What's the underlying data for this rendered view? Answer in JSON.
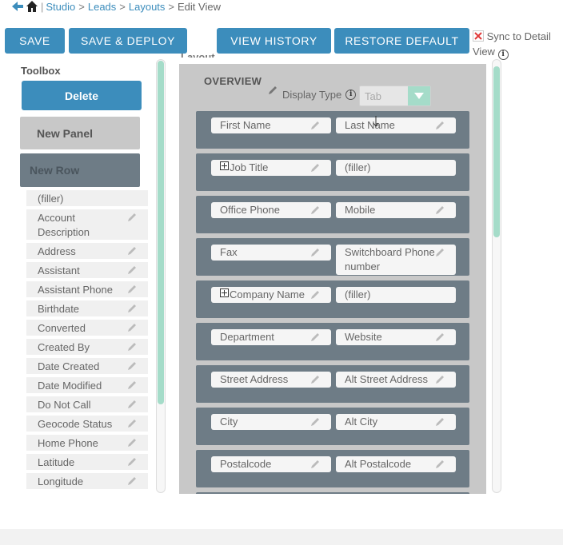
{
  "breadcrumb": {
    "items": [
      "Studio",
      "Leads",
      "Layouts"
    ],
    "separator": ">",
    "current": "Edit View"
  },
  "toolbar": {
    "save": "SAVE",
    "save_deploy": "SAVE & DEPLOY",
    "view_history": "VIEW HISTORY",
    "restore_default": "RESTORE DEFAULT",
    "sync_label": "Sync to Detail View"
  },
  "toolbox": {
    "title": "Toolbox",
    "delete": "Delete",
    "new_panel": "New Panel",
    "new_row": "New Row",
    "fields": [
      "(filler)",
      "Account Description",
      "Address",
      "Assistant",
      "Assistant Phone",
      "Birthdate",
      "Converted",
      "Created By",
      "Date Created",
      "Date Modified",
      "Do Not Call",
      "Geocode Status",
      "Home Phone",
      "Latitude",
      "Longitude"
    ]
  },
  "layout": {
    "label": "Layout",
    "panel_title": "OVERVIEW",
    "display_type_label": "Display Type",
    "display_type_value": "Tab",
    "rows": [
      [
        "First Name",
        "Last Name"
      ],
      [
        "Job Title",
        "(filler)"
      ],
      [
        "Office Phone",
        "Mobile"
      ],
      [
        "Fax",
        "Switchboard Phone number"
      ],
      [
        "Company Name",
        "(filler)"
      ],
      [
        "Department",
        "Website"
      ],
      [
        "Street Address",
        "Alt Street Address"
      ],
      [
        "City",
        "Alt City"
      ],
      [
        "Postalcode",
        "Alt Postalcode"
      ]
    ]
  },
  "colors": {
    "accent": "#3c8dbc",
    "scrollbar": "#a5dcc9",
    "row_bg": "#6e7c86",
    "panel_bg": "#c8c8c8"
  }
}
